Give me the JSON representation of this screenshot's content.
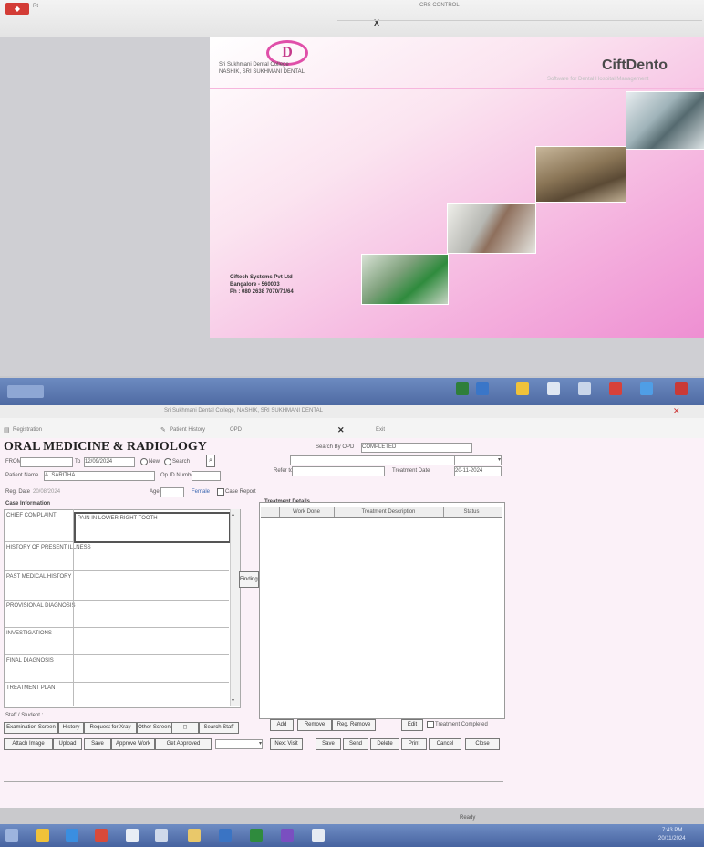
{
  "top_window": {
    "addr_fragment": "Rt",
    "toolbar_center": "CRS CONTROL",
    "toolbar_close_x": "X",
    "splash": {
      "product_name": "CiftDento",
      "product_subtitle": "Software for Dental Hospital Management",
      "institution_line1": "Sri Sukhmani Dental College",
      "institution_line2": "NASHIK, SRI SUKHMANI DENTAL",
      "company_line1": "Ciftech Systems Pvt Ltd",
      "company_line2": "Bangalore - 560003",
      "company_line3": "Ph : 080 2638 7070/71/64"
    }
  },
  "app_window": {
    "title_text": "Sri Sukhmani Dental College, NASHIK, SRI SUKHMANI DENTAL",
    "menu_registration": "Registration",
    "menu_patient_history": "Patient History",
    "menu_opd": "OPD",
    "menu_exit": "Exit",
    "form_title": "ORAL MEDICINE & RADIOLOGY",
    "search_label": "Search By OPD",
    "opd_value": "COMPLETED",
    "from_label": "FROM",
    "to_label": "To",
    "to_value": "12/09/2024",
    "new_label": "New",
    "search_btn": "Search",
    "patient_name_label": "Patient Name",
    "patient_name_value": "A. SARITHA",
    "opd_no_label": "Op ID Number",
    "reg_date_label": "Reg. Date",
    "reg_date_value": "20/08/2024",
    "age_label": "Age",
    "gender_label": "Female",
    "case_report_label": "Case Report",
    "referral_label": "Refer to",
    "date_label": "Date",
    "date_value": "20-11-2024",
    "treat_label": "Treatment Date",
    "case_info_title": "Case Information",
    "chief_complaint_label": "CHIEF COMPLAINT",
    "chief_complaint_value": "PAIN IN LOWER RIGHT TOOTH",
    "history_present_label": "HISTORY OF PRESENT ILLNESS",
    "past_medical_label": "PAST MEDICAL HISTORY",
    "provisional_label": "PROVISIONAL DIAGNOSIS",
    "investigations_label": "INVESTIGATIONS",
    "final_diagnosis_label": "FINAL DIAGNOSIS",
    "treatment_plan_label": "TREATMENT PLAN",
    "findings_btn": "Findings",
    "treatment_details_title": "Treatment Details",
    "col_work": "Work Done",
    "col_desc": "Treatment Description",
    "col_status": "Status",
    "staff_student_label": "Staff / Student :",
    "btn_examination": "Examination Screen",
    "btn_history": "History",
    "btn_request": "Request for Xray",
    "btn_other": "Other Screen",
    "btn_search_staff": "Search Staff",
    "btn_attach": "Attach Image",
    "btn_upload": "Upload",
    "btn_save_row": "Save",
    "btn_approve": "Approve Work",
    "btn_get_approve": "Get Approved",
    "btn_add": "Add",
    "btn_remove": "Remove",
    "btn_reg_remove": "Reg. Remove",
    "btn_edit": "Edit",
    "btn_next": "Next Visit",
    "btn_save": "Save",
    "btn_send": "Send",
    "btn_delete": "Delete",
    "btn_print": "Print",
    "btn_cancel": "Cancel",
    "btn_close": "Close",
    "treatment_completed": "Treatment Completed",
    "status_ready": "Ready"
  },
  "taskbar": {
    "start_label": "Start",
    "tray_time": "7:43 PM",
    "tray_date": "20/11/2024"
  },
  "colors": {
    "splash_pink": "#ee8fd2",
    "taskbar_blue": "#4e6aa3",
    "form_bg": "#fbf1f8",
    "logo_magenta": "#e04fa9"
  }
}
